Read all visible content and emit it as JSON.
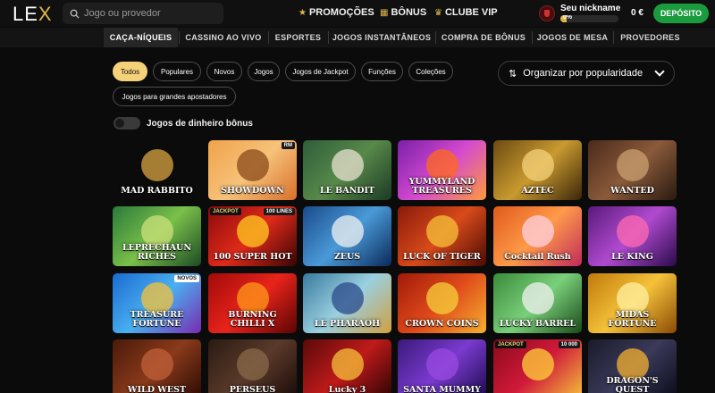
{
  "header": {
    "logo_text": "LE",
    "logo_accent": "X",
    "search_placeholder": "Jogo ou provedor",
    "nav": [
      {
        "icon": "star-icon",
        "label": "PROMOÇÕES"
      },
      {
        "icon": "gift-icon",
        "label": "BÔNUS"
      },
      {
        "icon": "crown-icon",
        "label": "CLUBE VIP"
      }
    ],
    "user": {
      "nickname": "Seu nickname",
      "progress_text": "0%",
      "progress": 0.1
    },
    "balance": "0 €",
    "deposit_label": "DEPÓSITO"
  },
  "tabs": [
    {
      "label": "CAÇA-NÍQUEIS",
      "active": true
    },
    {
      "label": "CASSINO AO VIVO"
    },
    {
      "label": "ESPORTES"
    },
    {
      "label": "JOGOS INSTANTÂNEOS"
    },
    {
      "label": "COMPRA DE BÔNUS"
    },
    {
      "label": "JOGOS DE MESA"
    },
    {
      "label": "PROVEDORES"
    }
  ],
  "filters": [
    {
      "label": "Todos",
      "active": true
    },
    {
      "label": "Populares"
    },
    {
      "label": "Novos"
    },
    {
      "label": "Jogos"
    },
    {
      "label": "Jogos de Jackpot"
    },
    {
      "label": "Funções"
    },
    {
      "label": "Coleções"
    },
    {
      "label": "Jogos para grandes apostadores"
    }
  ],
  "sort_label": "Organizar por popularidade",
  "bonus_toggle_label": "Jogos de dinheiro bônus",
  "colors": {
    "accent": "#e2b64a",
    "deposit": "#1a9c3e",
    "chip_active": "#f5d27a"
  },
  "games": [
    {
      "title": "MAD RABBITO",
      "bg": "linear-gradient(135deg,#6b2b8a,#c45aa0 60,#e28ab8)",
      "art": "#d9a441"
    },
    {
      "title": "SHOWDOWN",
      "bg": "linear-gradient(135deg,#f0a24a,#f7c27a 50%,#d86f2a)",
      "art": "#8a4a1a",
      "badge_r": "RM"
    },
    {
      "title": "LE BANDIT",
      "bg": "linear-gradient(135deg,#2e5d3a,#58894a 50%,#1c3a24)",
      "art": "#e8e2d0"
    },
    {
      "title": "YUMMYLAND TREASURES",
      "bg": "linear-gradient(135deg,#7a1fa8,#d44ad0 50%,#ff9a3a)",
      "art": "#ff6a1a"
    },
    {
      "title": "AZTEC",
      "bg": "linear-gradient(135deg,#6b4a12,#c99a30 50%,#3a2608)",
      "art": "#f5d27a"
    },
    {
      "title": "WANTED",
      "bg": "linear-gradient(135deg,#4a2a1a,#8a5a3a 50%,#2a1a10)",
      "art": "#c9a070"
    },
    {
      "title": "LEPRECHAUN RICHES",
      "bg": "linear-gradient(135deg,#2a7a3a,#7ac04a 50%,#1c4a24)",
      "art": "#c9e07a"
    },
    {
      "title": "100 SUPER HOT",
      "bg": "linear-gradient(135deg,#8a0a0a,#e02a1a 50%,#3a0404)",
      "art": "#ffcc22",
      "badge": "JACKPOT",
      "badge_r": "100 LINES"
    },
    {
      "title": "ZEUS",
      "bg": "linear-gradient(135deg,#1a4a8a,#4a9ad8 50%,#0a2a5a)",
      "art": "#f0f0f0"
    },
    {
      "title": "LUCK OF TIGER",
      "bg": "linear-gradient(135deg,#8a1a0a,#d84a1a 50%,#4a0a04)",
      "art": "#f5c23a"
    },
    {
      "title": "Cocktail Rush",
      "bg": "linear-gradient(135deg,#e05a1a,#ff9a4a 50%,#c02a5a)",
      "art": "#ffd0e0"
    },
    {
      "title": "LE KING",
      "bg": "linear-gradient(135deg,#5a1a7a,#b04ad0 50%,#2a0a4a)",
      "art": "#ff6ab0"
    },
    {
      "title": "TREASURE FORTUNE",
      "bg": "linear-gradient(135deg,#1a6ad0,#4ab0f0 50%,#7a2ab0)",
      "art": "#f5c23a",
      "badge_r": "NOVOS"
    },
    {
      "title": "BURNING CHILLI X",
      "bg": "linear-gradient(135deg,#a00a0a,#e8241a 50%,#5a0404)",
      "art": "#ff9a1a"
    },
    {
      "title": "LE PHARAOH",
      "bg": "linear-gradient(135deg,#3a7aa0,#9ad0e0 50%,#d0a040)",
      "art": "#2a4a8a"
    },
    {
      "title": "CROWN COINS",
      "bg": "linear-gradient(135deg,#a01a0a,#e04a1a 50%,#f5b030)",
      "art": "#f5d23a"
    },
    {
      "title": "LUCKY BARREL",
      "bg": "linear-gradient(135deg,#3a8a3a,#7ad07a 50%,#1a4a1a)",
      "art": "#f0f0f0"
    },
    {
      "title": "MIDAS FORTUNE",
      "bg": "linear-gradient(135deg,#c07a0a,#f5c23a 50%,#8a4a04)",
      "art": "#fff0a0"
    },
    {
      "title": "WILD WEST",
      "bg": "linear-gradient(135deg,#4a1a0a,#8a3a1a 50%,#2a0a04)",
      "art": "#c0603a"
    },
    {
      "title": "PERSEUS",
      "bg": "linear-gradient(135deg,#2a1a12,#5a3a2a 50%,#1a0a08)",
      "art": "#8a6a4a"
    },
    {
      "title": "Lucky 3",
      "bg": "linear-gradient(135deg,#5a0a0a,#c01a1a 50%,#2a0404)",
      "art": "#f5c23a"
    },
    {
      "title": "SANTA MUMMY",
      "bg": "linear-gradient(135deg,#3a1a7a,#7a3ad0 50%,#1a0a4a)",
      "art": "#9a4ae0"
    },
    {
      "title": "",
      "bg": "linear-gradient(135deg,#8a0a1a,#d01a3a 50%,#f5c23a)",
      "art": "#ffd23a",
      "badge": "JACKPOT",
      "badge_r": "10 000"
    },
    {
      "title": "DRAGON'S QUEST",
      "bg": "linear-gradient(135deg,#1a1a2a,#3a3a5a 50%,#0a0a1a)",
      "art": "#f5b030"
    }
  ]
}
